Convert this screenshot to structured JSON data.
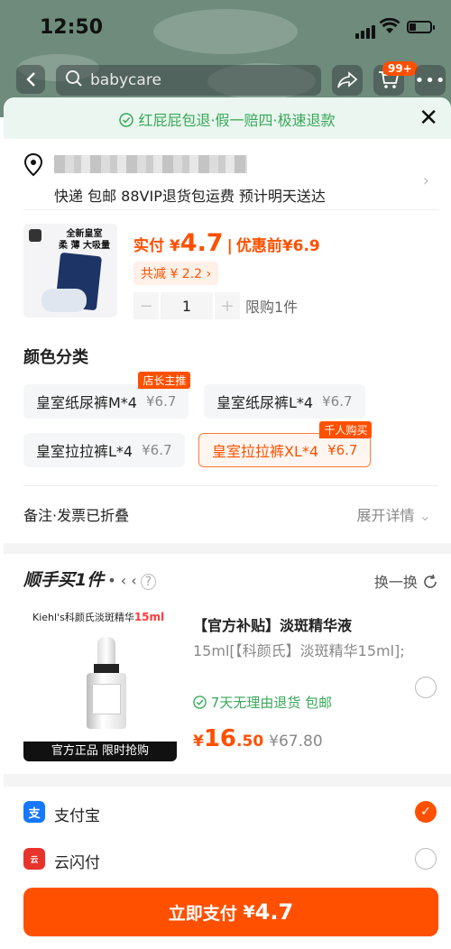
{
  "status": {
    "time": "12:50"
  },
  "nav": {
    "search_text": "babycare",
    "cart_badge": "99+"
  },
  "sheet": {
    "guarantee": "红屁屁包退·假一赔四·极速退款",
    "address": {
      "delivery": "快递 包邮 88VIP退货包运费 预计明天送达"
    },
    "product": {
      "package_text_line1": "全新皇室",
      "package_text_line2": "柔 薄 大吸量",
      "paid_label": "实付 ¥",
      "paid_amount": "4.7",
      "before_label": "优惠前",
      "before_amount": "¥6.9",
      "discount": "共减 ¥ 2.2 ›",
      "quantity": "1",
      "limit": "限购1件"
    },
    "color_section": {
      "title": "颜色分类",
      "options": [
        {
          "name": "皇室纸尿裤M*4",
          "price": "¥6.7",
          "tag": "店长主推"
        },
        {
          "name": "皇室纸尿裤L*4",
          "price": "¥6.7"
        },
        {
          "name": "皇室拉拉裤L*4",
          "price": "¥6.7"
        },
        {
          "name": "皇室拉拉裤XL*4",
          "price": "¥6.7",
          "tag": "千人购买",
          "selected": true
        }
      ]
    },
    "note": {
      "label": "备注·发票已折叠",
      "expand": "展开详情"
    },
    "addon": {
      "title": "顺手买1件",
      "swap": "换一换",
      "brand_text": "Kiehl's科颜氏淡斑精华",
      "brand_size": "15ml",
      "banner": "官方正品 限时抢购",
      "name": "【官方补贴】淡斑精华液",
      "desc": "15ml[【科颜氏】淡斑精华15ml];",
      "return_policy": "7天无理由退货 包邮",
      "price_currency": "¥",
      "price_int": "16",
      "price_dec": ".50",
      "orig_price": "¥67.80"
    },
    "payment": [
      {
        "name": "支付宝",
        "icon": "alipay-icon",
        "color": "#1677ff",
        "selected": true
      },
      {
        "name": "云闪付",
        "icon": "unionpay-icon",
        "color": "#e8332c",
        "selected": false
      }
    ],
    "pay_button": {
      "label": "立即支付",
      "currency": "¥",
      "amount": "4.7"
    }
  }
}
